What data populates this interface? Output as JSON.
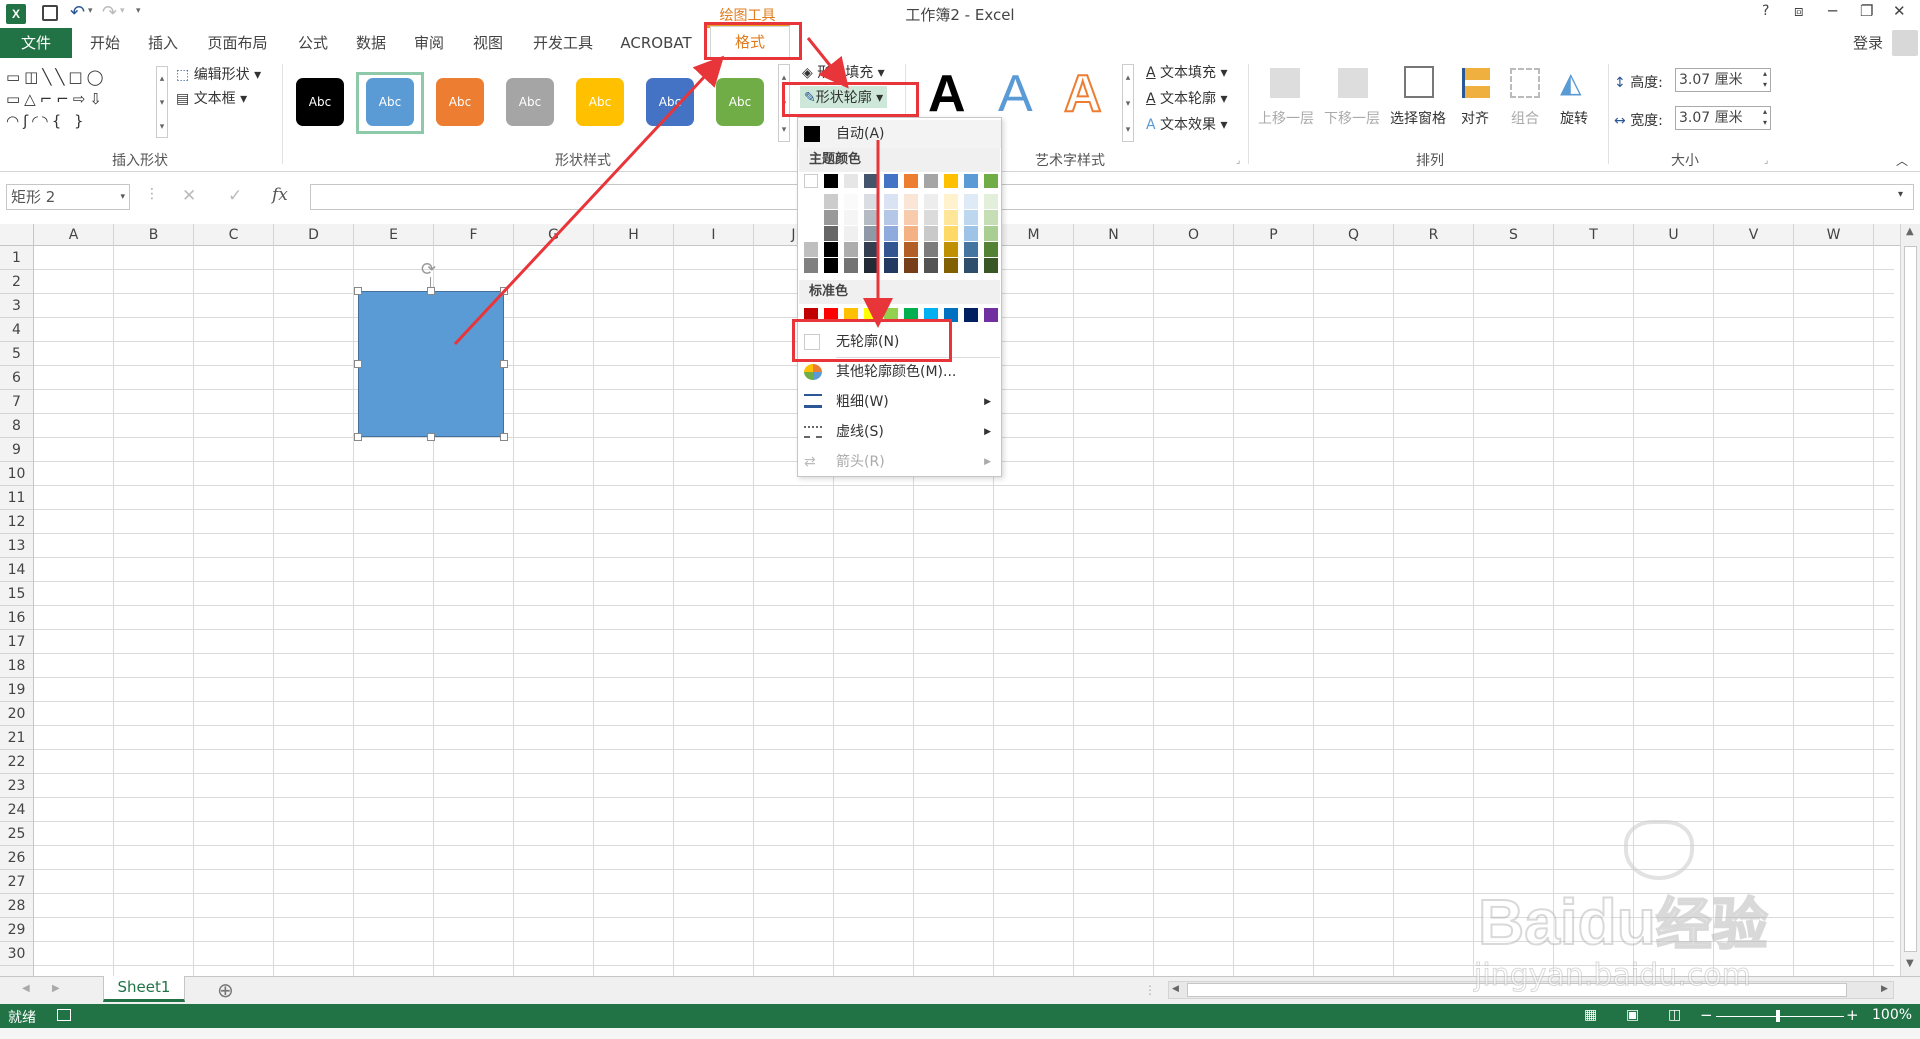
{
  "titlebar": {
    "doc_title": "工作簿2 - Excel",
    "context_tool": "绘图工具",
    "help": "?",
    "restore_ribbon": "⧈",
    "minimize": "─",
    "restore": "❐",
    "close": "✕"
  },
  "tabs": {
    "file": "文件",
    "home": "开始",
    "insert": "插入",
    "page_layout": "页面布局",
    "formulas": "公式",
    "data": "数据",
    "review": "审阅",
    "view": "视图",
    "developer": "开发工具",
    "acrobat": "ACROBAT",
    "format": "格式",
    "sign_in": "登录"
  },
  "ribbon": {
    "insert_shapes": {
      "edit_shape": "编辑形状",
      "text_box": "文本框",
      "label": "插入形状"
    },
    "shape_styles": {
      "style_text": "Abc",
      "label": "形状样式",
      "shape_fill": "形状填充",
      "shape_outline": "形状轮廓"
    },
    "wordart": {
      "letter": "A",
      "text_fill": "文本填充",
      "text_outline": "文本轮廓",
      "text_effects": "文本效果",
      "label": "艺术字样式"
    },
    "arrange": {
      "bring_forward": "上移一层",
      "send_backward": "下移一层",
      "selection_pane": "选择窗格",
      "align": "对齐",
      "group": "组合",
      "rotate": "旋转",
      "label": "排列"
    },
    "size": {
      "height_label": "高度:",
      "height_value": "3.07 厘米",
      "width_label": "宽度:",
      "width_value": "3.07 厘米",
      "label": "大小"
    }
  },
  "formula_bar": {
    "name_box": "矩形 2",
    "fx": "fx",
    "cancel": "✕",
    "enter": "✓",
    "value": ""
  },
  "columns": [
    "A",
    "B",
    "C",
    "D",
    "E",
    "F",
    "G",
    "H",
    "I",
    "J",
    "K",
    "L",
    "M",
    "N",
    "O",
    "P",
    "Q",
    "R",
    "S",
    "T",
    "U",
    "V",
    "W"
  ],
  "rows": [
    "1",
    "2",
    "3",
    "4",
    "5",
    "6",
    "7",
    "8",
    "9",
    "10",
    "11",
    "12",
    "13",
    "14",
    "15",
    "16",
    "17",
    "18",
    "19",
    "20",
    "21",
    "22",
    "23",
    "24",
    "25",
    "26",
    "27",
    "28",
    "29",
    "30"
  ],
  "menu": {
    "auto": "自动(A)",
    "theme_colors_header": "主题颜色",
    "standard_colors_header": "标准色",
    "no_outline": "无轮廓(N)",
    "more_colors": "其他轮廓颜色(M)...",
    "weight": "粗细(W)",
    "dashes": "虚线(S)",
    "arrows": "箭头(R)"
  },
  "colors": {
    "accent": "#217346",
    "shape_fill": "#5b9bd5",
    "highlight_red": "#e8353a",
    "context_orange": "#e89a1f",
    "style_buttons": [
      "#000000",
      "#5b9bd5",
      "#ed7d31",
      "#a5a5a5",
      "#ffc000",
      "#4472c4",
      "#70ad47"
    ],
    "theme_row": [
      "#ffffff",
      "#000000",
      "#e7e6e6",
      "#44546a",
      "#4472c4",
      "#ed7d31",
      "#a5a5a5",
      "#ffc000",
      "#5b9bd5",
      "#70ad47"
    ],
    "standard_row": [
      "#c00000",
      "#ff0000",
      "#ffc000",
      "#ffff00",
      "#92d050",
      "#00b050",
      "#00b0f0",
      "#0070c0",
      "#002060",
      "#7030a0"
    ]
  },
  "sheet_tabs": {
    "sheet1": "Sheet1",
    "add": "⊕"
  },
  "status": {
    "ready": "就绪",
    "zoom": "100%",
    "minus": "−",
    "plus": "+"
  },
  "watermark": {
    "brand": "Bai",
    "brand2": "du",
    "brand_cn": "经验",
    "url": "jingyan.baidu.com"
  }
}
